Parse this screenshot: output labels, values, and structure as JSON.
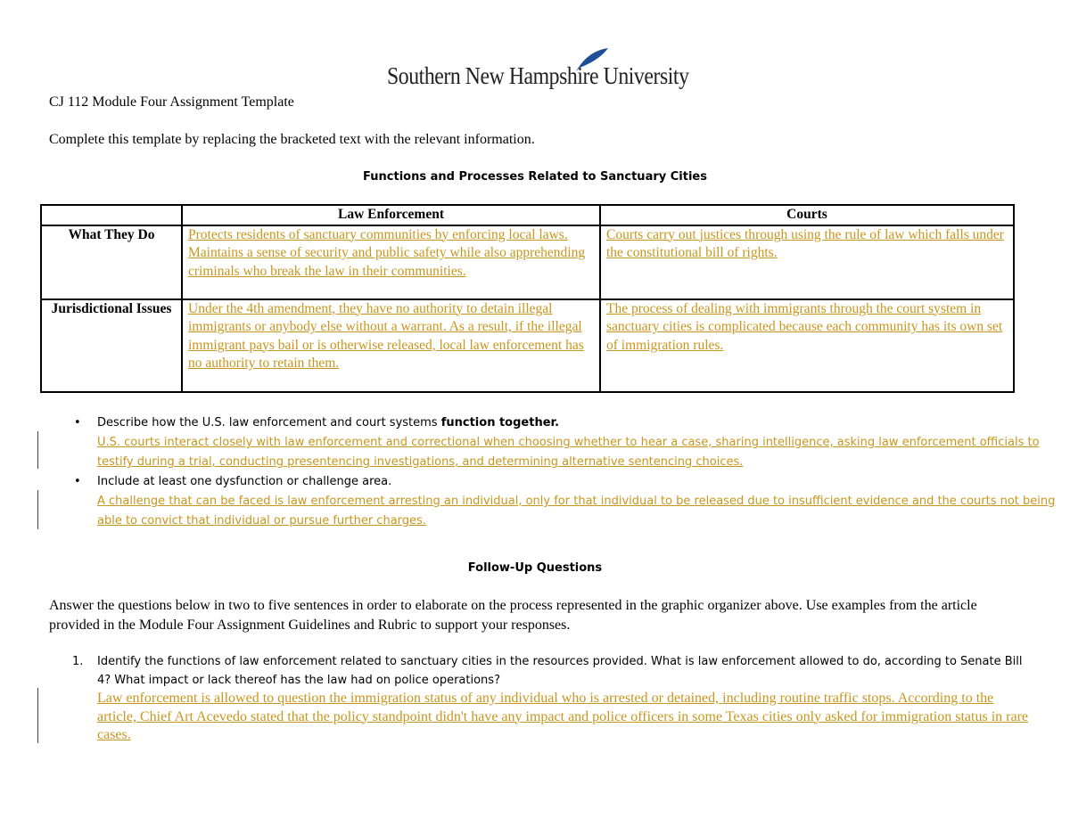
{
  "header": {
    "logo_text": "Southern New Hampshire University",
    "logo_color": "#1f4e99",
    "title": "CJ 112 Module Four Assignment Template",
    "instructions": "Complete this template by replacing the bracketed text with the relevant information."
  },
  "organizer": {
    "title": "Functions and Processes Related to Sanctuary Cities",
    "columns": [
      "",
      "Law Enforcement",
      "Courts"
    ],
    "rows": [
      {
        "label": "What They Do",
        "law_enforcement": "Protects residents of sanctuary communities by enforcing local laws. Maintains a sense of security and public safety while also apprehending criminals who break the law in their communities.",
        "courts": "Courts carry out justices through using the rule of law which falls under the constitutional bill of rights."
      },
      {
        "label": "Jurisdictional Issues",
        "law_enforcement": "Under the 4th amendment, they have no authority to detain illegal immigrants or anybody else without a warrant. As a result, if the illegal immigrant pays bail or is otherwise released, local law enforcement has no authority to retain them.",
        "courts": "The process of dealing with immigrants through the court system in sanctuary cities is complicated because each community has its own set of immigration rules."
      }
    ]
  },
  "bullets": [
    {
      "prompt": "Describe how the U.S. law enforcement and court systems ",
      "prompt_bold": "function together.",
      "answer": "U.S. courts interact closely with law enforcement and correctional when choosing whether to hear a case, sharing intelligence, asking law enforcement officials to testify during a trial, conducting presentencing investigations, and determining alternative sentencing choices."
    },
    {
      "prompt": "Include at least one dysfunction or challenge area.",
      "prompt_bold": "",
      "answer": "A challenge that can be faced is law enforcement arresting an individual, only for that individual to be released due to insufficient evidence and the courts not being able to convict that individual or pursue further charges."
    }
  ],
  "follow_up": {
    "title": "Follow-Up Questions",
    "instructions": "Answer the questions below in two to five sentences in order to elaborate on the process represented in the graphic organizer above. Use examples from the article provided in the Module Four Assignment Guidelines and Rubric to support your responses.",
    "questions": [
      {
        "number": "1.",
        "question": "Identify the functions of law enforcement related to sanctuary cities in the resources provided. What is law enforcement allowed to do, according to Senate Bill 4? What impact or lack thereof has the law had on police operations?",
        "answer": "Law enforcement is allowed to question the immigration status of any individual who is arrested or detained, including routine traffic stops. According to the article, Chief Art Acevedo stated that the policy standpoint didn't have any impact and police officers in some Texas cities only asked for immigration status in rare cases."
      }
    ]
  },
  "colors": {
    "answer_text": "#c8961c"
  }
}
